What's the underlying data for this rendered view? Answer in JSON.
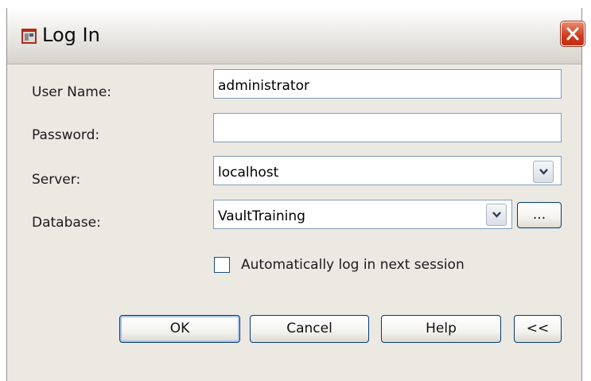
{
  "window": {
    "title": "Log In"
  },
  "form": {
    "username_label": "User Name:",
    "username_value": "administrator",
    "password_label": "Password:",
    "password_value": "",
    "server_label": "Server:",
    "server_value": "localhost",
    "database_label": "Database:",
    "database_value": "VaultTraining",
    "browse_label": "...",
    "auto_login_label": "Automatically log in next session",
    "auto_login_checked": false
  },
  "buttons": {
    "ok": "OK",
    "cancel": "Cancel",
    "help": "Help",
    "collapse": "<<"
  },
  "colors": {
    "dialog_bg": "#ece9e3",
    "input_border": "#7f9db9",
    "button_border": "#003c74",
    "close_red": "#d0391b"
  }
}
